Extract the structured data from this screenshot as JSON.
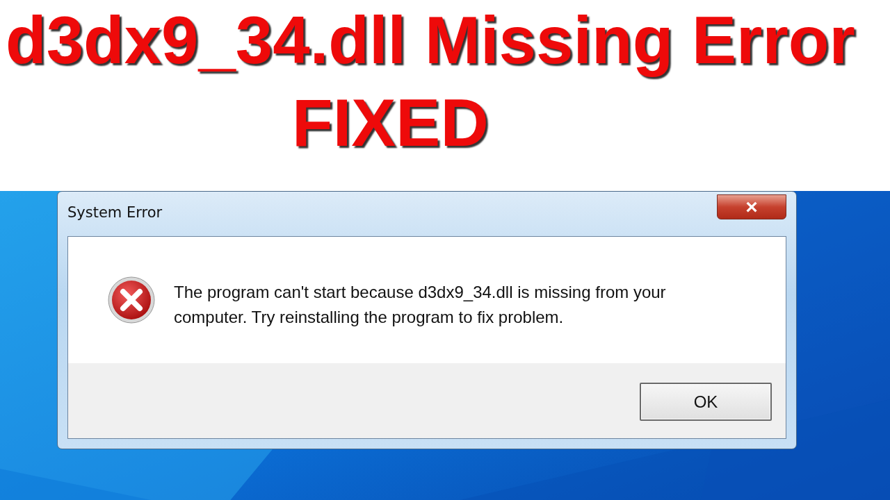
{
  "headline": {
    "lines": [
      "d3dx9_34.dll Missing Error",
      "FIXED"
    ]
  },
  "dialog": {
    "title": "System Error",
    "close": "×",
    "message": "The program can't start because d3dx9_34.dll is missing from your computer. Try reinstalling the program to fix problem.",
    "buttons": [
      {
        "label": "OK",
        "selected": true
      }
    ]
  }
}
